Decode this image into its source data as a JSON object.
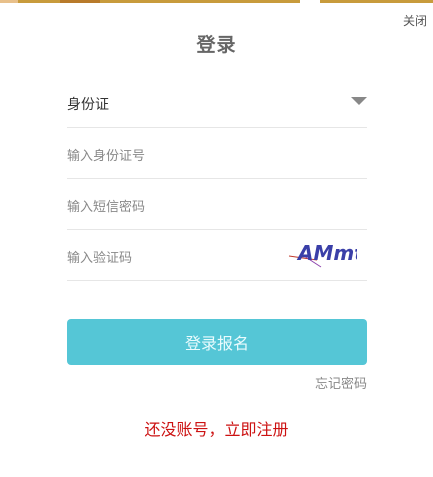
{
  "header": {
    "close_label": "关闭",
    "title": "登录"
  },
  "form": {
    "id_type_selected": "身份证",
    "id_number_placeholder": "输入身份证号",
    "sms_code_placeholder": "输入短信密码",
    "captcha_placeholder": "输入验证码",
    "captcha_text": "AMmt"
  },
  "actions": {
    "login_label": "登录报名",
    "forgot_label": "忘记密码",
    "register_label": "还没账号，立即注册"
  },
  "colors": {
    "primary_button": "#55c6d6",
    "register_link": "#cc1111",
    "captcha_text": "#3a3fa8"
  },
  "icons": {
    "dropdown": "chevron-down-icon"
  }
}
